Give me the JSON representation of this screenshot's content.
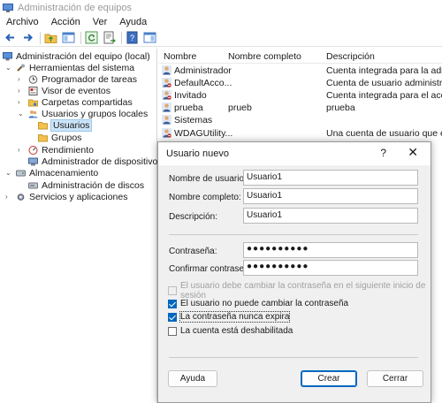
{
  "window": {
    "title": "Administración de equipos"
  },
  "menu": [
    "Archivo",
    "Acción",
    "Ver",
    "Ayuda"
  ],
  "tree": {
    "root": "Administración del equipo (local)",
    "system_tools": "Herramientas del sistema",
    "task_scheduler": "Programador de tareas",
    "event_viewer": "Visor de eventos",
    "shared_folders": "Carpetas compartidas",
    "local_users_groups": "Usuarios y grupos locales",
    "users": "Usuarios",
    "groups": "Grupos",
    "performance": "Rendimiento",
    "device_manager": "Administrador de dispositivos",
    "storage": "Almacenamiento",
    "disk_management": "Administración de discos",
    "services_apps": "Servicios y aplicaciones"
  },
  "list": {
    "columns": [
      "Nombre",
      "Nombre completo",
      "Descripción"
    ],
    "rows": [
      {
        "name": "Administrador",
        "full": "",
        "desc": "Cuenta integrada para la administ"
      },
      {
        "name": "DefaultAcco...",
        "full": "",
        "desc": "Cuenta de usuario administrada p"
      },
      {
        "name": "Invitado",
        "full": "",
        "desc": "Cuenta integrada para el acceso c"
      },
      {
        "name": "prueba",
        "full": "prueb",
        "desc": "prueba"
      },
      {
        "name": "Sistemas",
        "full": "",
        "desc": ""
      },
      {
        "name": "WDAGUtility...",
        "full": "",
        "desc": "Una cuenta de usuario que el siste"
      }
    ]
  },
  "dialog": {
    "title": "Usuario nuevo",
    "help": "?",
    "close": "✕",
    "username_label": "Nombre de usuario:",
    "username_value": "Usuario1",
    "fullname_label": "Nombre completo:",
    "fullname_value": "Usuario1",
    "description_label": "Descripción:",
    "description_value": "Usuario1",
    "password_label": "Contraseña:",
    "password_value": "●●●●●●●●●●",
    "confirm_label": "Confirmar contraseña:",
    "confirm_value": "●●●●●●●●●●",
    "chk_must_change": "El usuario debe cambiar la contraseña en el siguiente inicio de sesión",
    "chk_cannot_change": "El usuario no puede cambiar la contraseña",
    "chk_never_expires": "La contraseña nunca expira",
    "chk_disabled": "La cuenta está deshabilitada",
    "help_button": "Ayuda",
    "create_button": "Crear",
    "close_button": "Cerrar"
  },
  "colors": {
    "accent": "#0067c0",
    "selection": "#cce4f7",
    "folder": "#f2c14e"
  }
}
